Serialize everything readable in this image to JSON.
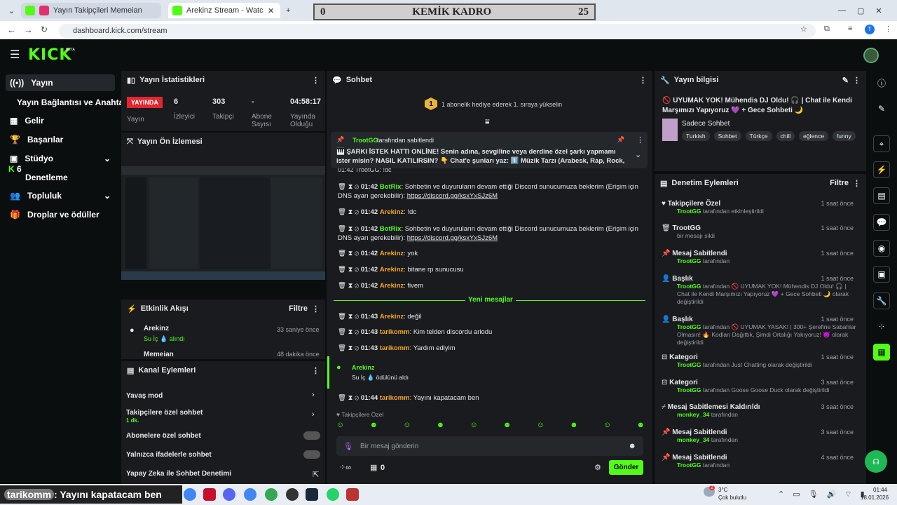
{
  "browser": {
    "tabs": [
      {
        "label": "Yayın Takipçileri Memeian"
      },
      {
        "label": "Arekinz Stream - Watch Live on"
      }
    ],
    "url": "dashboard.kick.com/stream",
    "profile_letter": "T"
  },
  "overlay": {
    "left": "0",
    "title": "KEMİK KADRO",
    "right": "25"
  },
  "brand": {
    "logo": "KICK",
    "beta": "BETA"
  },
  "nav": {
    "items": [
      "Yayın",
      "Yayın Bağlantısı ve Anahtarı",
      "Gelir",
      "Başarılar",
      "Stüdyo",
      "Denetleme",
      "Topluluk",
      "Droplar ve ödüller"
    ],
    "overlay_badge": "6"
  },
  "stats": {
    "title": "Yayın İstatistikleri",
    "live": "YAYINDA",
    "live_label": "Yayın",
    "viewers": "6",
    "viewers_label": "İzleyici",
    "followers": "303",
    "followers_label": "Takipçi",
    "subs": "-",
    "subs_label": "Abone Sayısı",
    "uptime": "04:58:17",
    "uptime_label": "Yayında Olduğu"
  },
  "preview": {
    "title": "Yayın Ön İzlemesi"
  },
  "activity": {
    "title": "Etkinlik Akışı",
    "filter": "Filtre",
    "items": [
      {
        "user": "Arekinz",
        "detail": "Su İç 💧 alındı",
        "time": "33 saniye önce"
      },
      {
        "user": "Memeian",
        "time": "48 dakika önce"
      }
    ]
  },
  "channel_actions": {
    "title": "Kanal Eylemleri",
    "items": [
      {
        "label": "Yavaş mod"
      },
      {
        "label": "Takipçilere özel sohbet",
        "sub": "1 dk."
      },
      {
        "label": "Abonelere özel sohbet"
      },
      {
        "label": "Yalnızca ifadelerle sohbet"
      },
      {
        "label": "Yapay Zeka ile Sohbet Denetimi"
      }
    ]
  },
  "chat": {
    "title": "Sohbet",
    "goal_num": "1",
    "goal_text": "1 abonelik hediye ederek 1. sıraya yükselin",
    "pinned_by": "TrootGG",
    "pinned_by_suffix": "tarafından sabitlendi",
    "pinned_text": "🎹 ŞARKI İSTEK HATTI ONLİNE! Senin adına, sevgiline veya derdine özel şarkı yapmamı ister misin? NASIL KATILIRSIN? 👇 Chat'e şunları yaz: 1️⃣ Müzik Tarzı (Arabesk, Rap, Rock, Pop.....",
    "partial_top": "01:42  TrootGG: !dc",
    "messages": [
      {
        "time": "01:42",
        "user": "BotRix",
        "text": "Sohbetin ve duyuruların devam ettiği Discord sunucumuza beklerim (Erişim için DNS ayarı gerekebilir):",
        "link": "https://discord.gg/ksxYxSJz6M"
      },
      {
        "time": "01:42",
        "user": "Arekinz",
        "text": "!dc"
      },
      {
        "time": "01:42",
        "user": "BotRix",
        "text": "Sohbetin ve duyuruların devam ettiği Discord sunucumuza beklerim (Erişim için DNS ayarı gerekebilir):",
        "link": "https://discord.gg/ksxYxSJz6M"
      },
      {
        "time": "01:42",
        "user": "Arekinz",
        "text": "yok"
      },
      {
        "time": "01:42",
        "user": "Arekinz",
        "text": "bitane rp sunucusu"
      },
      {
        "time": "01:42",
        "user": "Arekinz",
        "text": "fivem"
      },
      {
        "time": "01:43",
        "user": "Arekinz",
        "text": "değil"
      },
      {
        "time": "01:43",
        "user": "tarikomm",
        "text": "Kim telden discordu ariodu"
      },
      {
        "time": "01:43",
        "user": "tarikomm",
        "text": "Yardım ediyim"
      },
      {
        "time": "01:44",
        "user": "tarikomm",
        "text": "Yayını kapatacam ben"
      }
    ],
    "new_messages": "Yeni mesajlar",
    "redeem_user": "Arekinz",
    "redeem_text": "Su İç 💧 ödülünü aldı",
    "followers_only": "Takipçilere Özel",
    "placeholder": "Bir mesaj gönderin",
    "send": "Gönder",
    "count": "0"
  },
  "info": {
    "title": "Yayın bilgisi",
    "stream_title": "🚫 UYUMAK YOK! Mühendis DJ Oldu! 🎧 | Chat ile Kendi Marşımızı Yapıyoruz 💜 + Gece Sohbeti 🌙",
    "category": "Sadece Sohbet",
    "tags": [
      "Turkish",
      "Sohbet",
      "Türkçe",
      "chill",
      "eğlence",
      "funny"
    ]
  },
  "mod": {
    "title": "Denetim Eylemleri",
    "filter": "Filtre",
    "items": [
      {
        "title": "Takipçilere Özel",
        "user": "TrootGG",
        "desc": "tarafından etkinleştirildi",
        "time": "1 saat önce"
      },
      {
        "title": "TrootGG",
        "user": "",
        "desc": "bir mesajı sildi",
        "time": "1 saat önce"
      },
      {
        "title": "Mesaj Sabitlendi",
        "user": "TrootGG",
        "desc": "tarafından",
        "time": "1 saat önce"
      },
      {
        "title": "Başlık",
        "user": "TrootGG",
        "desc": "tarafından 🚫 UYUMAK YOK! Mühendis DJ Oldu! 🎧 | Chat ile Kendi Marşımızı Yapıyoruz 💜 + Gece Sohbeti 🌙 olarak değiştirildi",
        "time": "1 saat önce"
      },
      {
        "title": "Başlık",
        "user": "TrootGG",
        "desc": "tarafından 🚫 UYUMAK YASAK! | 300+ Şerefine Sabahlar Olmasın! 🔥 Kodları Dağıttık, Şimdi Ortalığı Yakıyoruz! 😈 olarak değiştirildi",
        "time": "1 saat önce"
      },
      {
        "title": "Kategori",
        "user": "TrootGG",
        "desc": "tarafından Just Chatting olarak değiştirildi",
        "time": "1 saat önce"
      },
      {
        "title": "Kategori",
        "user": "TrootGG",
        "desc": "tarafından Goose Goose Duck olarak değiştirildi",
        "time": "3 saat önce"
      },
      {
        "title": "Mesaj Sabitlemesi Kaldırıldı",
        "user": "monkey_34",
        "desc": "tarafından",
        "time": "3 saat önce"
      },
      {
        "title": "Mesaj Sabitlendi",
        "user": "monkey_34",
        "desc": "tarafından",
        "time": "3 saat önce"
      },
      {
        "title": "Mesaj Sabitlendi",
        "user": "TrootGG",
        "desc": "tarafından",
        "time": "4 saat önce"
      }
    ]
  },
  "taskbar": {
    "overlay_user": "tarikomm",
    "overlay_text": ": Yayını kapatacam ben",
    "temp": "3°C",
    "weather": "Çok bulutlu",
    "time": "01:44",
    "date": "18.01.2026",
    "weather_badge": "2"
  }
}
